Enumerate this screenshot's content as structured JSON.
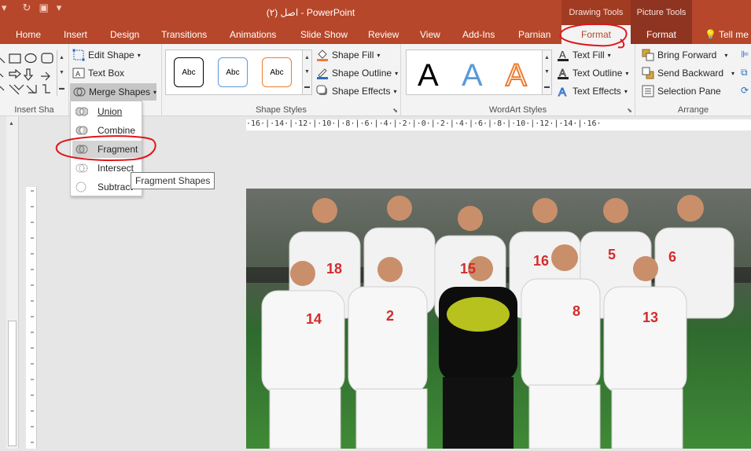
{
  "title_bar": {
    "document_title": "اصل (۲) - PowerPoint",
    "context_drawing": "Drawing Tools",
    "context_picture": "Picture Tools",
    "qat_icons": [
      "refresh-icon",
      "slideshow-icon",
      "dropdown-icon"
    ]
  },
  "tabs": [
    {
      "label": "Home"
    },
    {
      "label": "Insert"
    },
    {
      "label": "Design"
    },
    {
      "label": "Transitions"
    },
    {
      "label": "Animations"
    },
    {
      "label": "Slide Show"
    },
    {
      "label": "Review"
    },
    {
      "label": "View"
    },
    {
      "label": "Add-Ins"
    },
    {
      "label": "Parnian"
    },
    {
      "label": "Format"
    },
    {
      "label": "Format"
    }
  ],
  "tell_me": "Tell me",
  "ribbon": {
    "insert_shapes": {
      "label": "Insert Sha",
      "edit_shape": "Edit Shape",
      "text_box": "Text Box",
      "merge_shapes": "Merge Shapes"
    },
    "shape_styles": {
      "label": "Shape Styles",
      "gallery": [
        {
          "text": "Abc",
          "border": "#000000"
        },
        {
          "text": "Abc",
          "border": "#5b9bd5"
        },
        {
          "text": "Abc",
          "border": "#ed7d31"
        }
      ],
      "shape_fill": "Shape Fill",
      "shape_outline": "Shape Outline",
      "shape_effects": "Shape Effects"
    },
    "wordart_styles": {
      "label": "WordArt Styles",
      "gallery": [
        {
          "text": "A",
          "color": "#000000"
        },
        {
          "text": "A",
          "color": "#5b9bd5"
        },
        {
          "text": "A",
          "color": "#ed7d31"
        }
      ],
      "text_fill": "Text Fill",
      "text_outline": "Text Outline",
      "text_effects": "Text Effects"
    },
    "arrange": {
      "label": "Arrange",
      "bring_forward": "Bring Forward",
      "send_backward": "Send Backward",
      "selection_pane": "Selection Pane"
    }
  },
  "merge_menu": {
    "items": [
      {
        "label": "Union"
      },
      {
        "label": "Combine"
      },
      {
        "label": "Fragment"
      },
      {
        "label": "Intersect"
      },
      {
        "label": "Subtract"
      }
    ],
    "tooltip": "Fragment Shapes"
  },
  "ruler": {
    "marks": "·16·|·14·|·12·|·10·|·8·|·6·|·4·|·2·|·0·|·2·|·4·|·6·|·8·|·10·|·12·|·14·|·16·"
  },
  "photo": {
    "jersey_numbers": [
      "18",
      "15",
      "16",
      "5",
      "6",
      "14",
      "2",
      "8",
      "13"
    ]
  },
  "colors": {
    "accent": "#b7472a",
    "annotation": "#e0161b"
  }
}
